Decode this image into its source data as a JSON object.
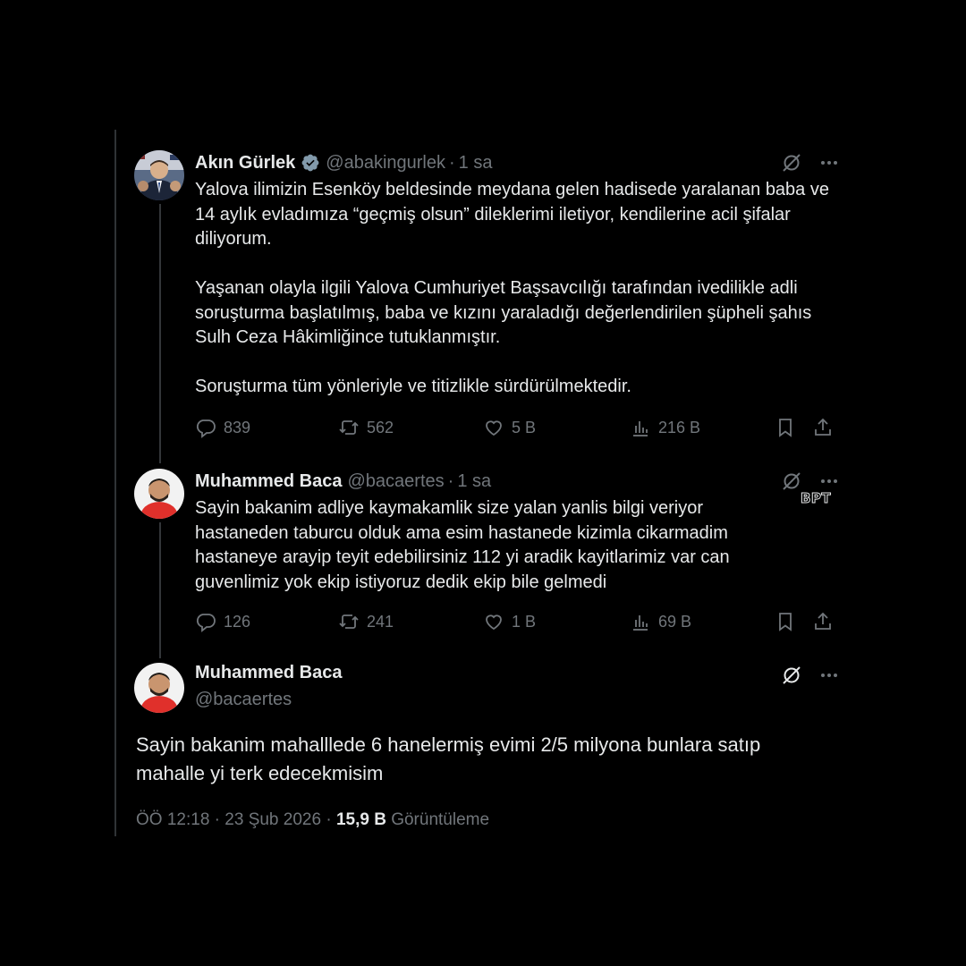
{
  "colors": {
    "background": "#000000",
    "text": "#e7e9ea",
    "muted": "#71767b",
    "verified": "#829aab"
  },
  "tweets": [
    {
      "name": "Akın Gürlek",
      "handle": "@abakingurlek",
      "separator": "·",
      "time": "1 sa",
      "verified": true,
      "paragraphs": [
        "Yalova ilimizin Esenköy beldesinde meydana gelen hadisede yaralanan baba ve 14 aylık evladımıza “geçmiş olsun” dileklerimi iletiyor, kendilerine acil şifalar diliyorum.",
        "Yaşanan olayla ilgili Yalova Cumhuriyet Başsavcılığı tarafından ivedilikle adli soruşturma başlatılmış, baba ve kızını yaraladığı değerlendirilen şüpheli şahıs Sulh Ceza Hâkimliğince tutuklanmıştır.",
        "Soruşturma tüm yönleriyle ve titizlikle sürdürülmektedir."
      ],
      "replies": "839",
      "reposts": "562",
      "likes": "5 B",
      "views": "216 B"
    },
    {
      "name": "Muhammed Baca",
      "handle": "@bacaertes",
      "separator": "·",
      "time": "1 sa",
      "paragraphs": [
        "Sayin bakanim adliye kaymakamlik size yalan yanlis bilgi veriyor hastaneden taburcu olduk ama esim hastanede kizimla cikarmadim hastaneye arayip teyit edebilirsiniz 112 yi aradik kayitlarimiz var can guvenlimiz yok ekip istiyoruz dedik ekip bile gelmedi"
      ],
      "replies": "126",
      "reposts": "241",
      "likes": "1 B",
      "views": "69 B"
    }
  ],
  "main_tweet": {
    "name": "Muhammed Baca",
    "handle": "@bacaertes",
    "text": "Sayin bakanim mahalllede 6 hanelermiş evimi 2/5 milyona bunlara satıp mahalle yi terk edecekmisim",
    "time": "ÖÖ 12:18",
    "separator": "·",
    "date": "23 Şub 2026",
    "views_count": "15,9 B",
    "views_label": "Görüntüleme"
  },
  "watermark": "BPT",
  "icons": [
    "grok-icon",
    "more-icon",
    "reply-icon",
    "repost-icon",
    "like-icon",
    "views-icon",
    "bookmark-icon",
    "share-icon",
    "verified-badge-icon"
  ]
}
